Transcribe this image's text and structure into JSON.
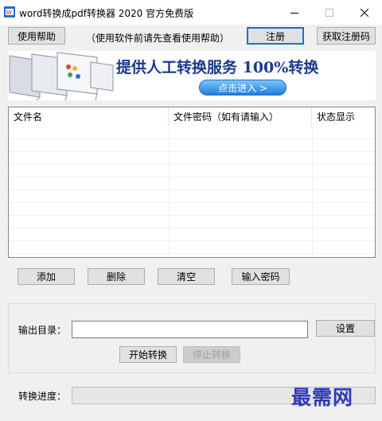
{
  "window": {
    "title": "word转换成pdf转换器 2020 官方免费版"
  },
  "toolbar": {
    "help_label": "使用帮助",
    "hint_text": "（使用软件前请先查看使用帮助）",
    "register_label": "注册",
    "get_code_label": "获取注册码"
  },
  "banner": {
    "headline": "提供人工转换服务 100%转换",
    "cta_label": "点击进入 >"
  },
  "file_list": {
    "columns": [
      "文件名",
      "文件密码（如有请输入）",
      "状态显示"
    ],
    "rows": []
  },
  "actions": {
    "add_label": "添加",
    "delete_label": "删除",
    "clear_label": "清空",
    "password_label": "输入密码"
  },
  "output": {
    "dir_label": "输出目录：",
    "dir_value": "",
    "settings_label": "设置",
    "start_label": "开始转换",
    "stop_label": "停止转换"
  },
  "progress": {
    "label": "转换进度：",
    "value": 0
  },
  "watermark": "最需网",
  "colors": {
    "accent": "#0078d7",
    "banner_text": "#1a3a8a",
    "watermark": "#2e3bb8"
  }
}
